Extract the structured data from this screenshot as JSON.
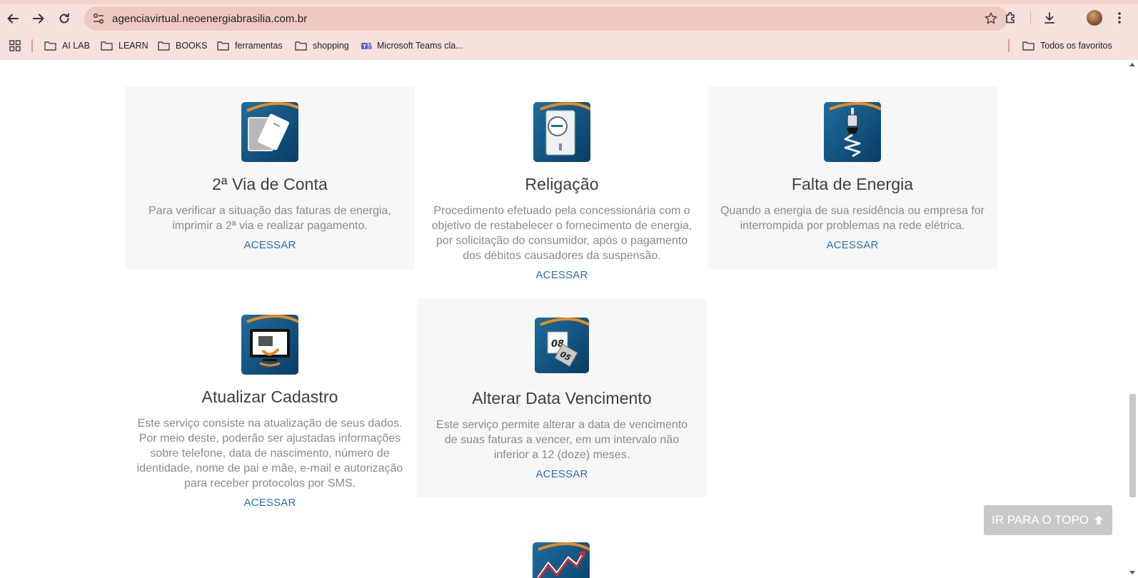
{
  "browser": {
    "url": "agenciavirtual.neoenergiabrasilia.com.br",
    "bookmarks": [
      {
        "label": "AI LAB",
        "icon": "folder-icon"
      },
      {
        "label": "LEARN",
        "icon": "folder-icon"
      },
      {
        "label": "BOOKS",
        "icon": "folder-icon"
      },
      {
        "label": "ferramentas",
        "icon": "folder-icon"
      },
      {
        "label": "shopping",
        "icon": "folder-icon"
      },
      {
        "label": "Microsoft Teams cla...",
        "icon": "teams-icon"
      }
    ],
    "all_bookmarks_label": "Todos os favoritos"
  },
  "services": [
    {
      "icon": "bill-card-icon",
      "title": "2ª Via de Conta",
      "description": "Para verificar a situação das faturas de energia, imprimir a 2ª via e realizar pagamento.",
      "link": "ACESSAR"
    },
    {
      "icon": "electric-meter-icon",
      "title": "Religação",
      "description": "Procedimento efetuado pela concessionária com o objetivo de restabelecer o fornecimento de energia, por solicitação do consumidor, após o pagamento dos débitos causadores da suspensão.",
      "link": "ACESSAR"
    },
    {
      "icon": "power-outage-icon",
      "title": "Falta de Energia",
      "description": "Quando a energia de sua residência ou empresa for interrompida por problemas na rede elétrica.",
      "link": "ACESSAR"
    },
    {
      "icon": "update-registration-icon",
      "title": "Atualizar Cadastro",
      "description": "Este serviço consiste na atualização de seus dados. Por meio deste, poderão ser ajustadas informações sobre telefone, data de nascimento, número de identidade, nome de pai e mãe, e-mail e autorização para receber protocolos por SMS.",
      "link": "ACESSAR"
    },
    {
      "icon": "calendar-change-icon",
      "title": "Alterar Data Vencimento",
      "description": "Este serviço permite alterar a data de vencimento de suas faturas a vencer, em um intervalo não inferior a 12 (doze) meses.",
      "link": "ACESSAR",
      "icon_text_top": "08",
      "icon_text_bottom": "05"
    }
  ],
  "back_to_top": "IR PARA O TOPO",
  "colors": {
    "chrome_bg": "#f7e1dc",
    "card_bg": "#f7f7f7",
    "link": "#2d6ea8",
    "icon_blue": "#0b4f7d",
    "icon_orange": "#e98a1e"
  }
}
